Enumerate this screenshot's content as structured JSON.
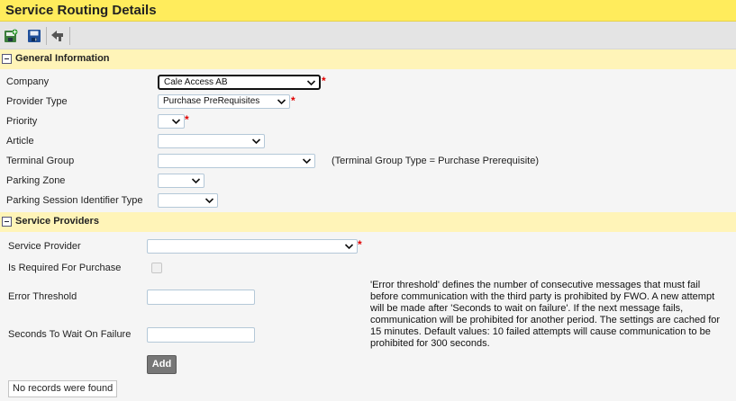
{
  "title": "Service Routing Details",
  "toolbar": {
    "buttons": [
      {
        "icon": "save-new-icon"
      },
      {
        "icon": "save-icon"
      },
      {
        "icon": "back-icon"
      }
    ]
  },
  "general": {
    "header": "General Information",
    "company": {
      "label": "Company",
      "value": "Cale Access AB"
    },
    "provider_type": {
      "label": "Provider Type",
      "value": "Purchase PreRequisites"
    },
    "priority": {
      "label": "Priority",
      "value": ""
    },
    "article": {
      "label": "Article",
      "value": ""
    },
    "terminal_group": {
      "label": "Terminal Group",
      "value": "",
      "hint": "(Terminal Group Type = Purchase Prerequisite)"
    },
    "parking_zone": {
      "label": "Parking Zone",
      "value": ""
    },
    "session_id_type": {
      "label": "Parking Session Identifier Type",
      "value": ""
    }
  },
  "providers": {
    "header": "Service Providers",
    "service_provider": {
      "label": "Service Provider",
      "value": ""
    },
    "is_required": {
      "label": "Is Required For Purchase",
      "checked": false
    },
    "error_threshold": {
      "label": "Error Threshold",
      "value": ""
    },
    "seconds_wait": {
      "label": "Seconds To Wait On Failure",
      "value": ""
    },
    "note": "'Error threshold' defines the number of consecutive messages that must fail before communication with the third party is prohibited by FWO. A new attempt will be made after 'Seconds to wait on failure'. If the next message fails, communication will be prohibited for another period. The settings are cached for 15 minutes. Default values: 10 failed attempts will cause communication to be prohibited for 300 seconds.",
    "add_label": "Add",
    "empty_text": "No records were found"
  },
  "colors": {
    "title_bg": "#ffec5c",
    "section_bg": "#fff4b8",
    "required": "#e00000"
  }
}
